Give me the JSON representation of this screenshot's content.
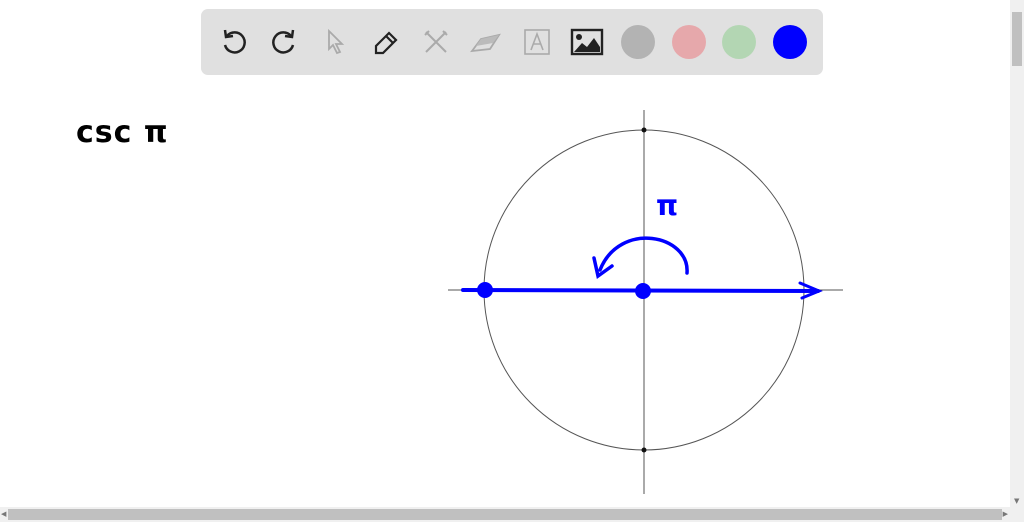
{
  "toolbar": {
    "tools": [
      "undo-icon",
      "redo-icon",
      "select-icon",
      "pen-icon",
      "tools-icon",
      "eraser-icon",
      "text-icon",
      "image-icon"
    ],
    "colors": [
      "#b3b3b3",
      "#e6a8ab",
      "#b3d6b3",
      "#0000ff"
    ],
    "selected_color": "#0000ff"
  },
  "canvas": {
    "expression": "csc π",
    "angle_label": "π",
    "ink_color": "#0000ff"
  }
}
